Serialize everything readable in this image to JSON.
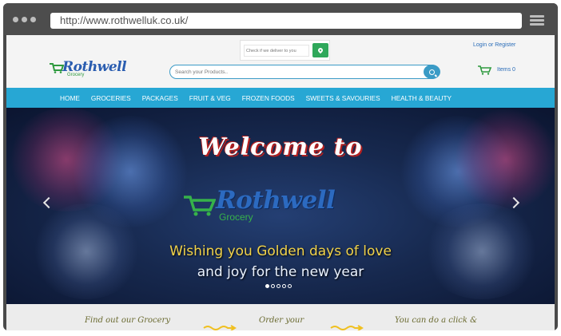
{
  "browser": {
    "url": "http://www.rothwelluk.co.uk/"
  },
  "header": {
    "deliver_placeholder": "Check if we deliver to you",
    "login_label": "Login or Register",
    "logo_text": "Rothwell",
    "logo_sub": "Grocery",
    "search_placeholder": "Search your Products..",
    "cart_label": "Items 0"
  },
  "nav": {
    "items": [
      "HOME",
      "GROCERIES",
      "PACKAGES",
      "FRUIT & VEG",
      "FROZEN FOODS",
      "SWEETS & SAVOURIES",
      "HEALTH & BEAUTY"
    ]
  },
  "hero": {
    "welcome": "Welcome to",
    "logo_text": "Rothwell",
    "logo_sub": "Grocery",
    "tagline_1": "Wishing you Golden days of love",
    "tagline_2": "and joy for the new year",
    "slides": 5,
    "active_slide": 1
  },
  "steps": {
    "step_1": "Find out our Grocery",
    "step_2": "Order your",
    "step_3": "You can do a click &"
  },
  "colors": {
    "nav_bg": "#27a7d4",
    "brand_blue": "#2a5db0",
    "brand_green": "#2e9a3e",
    "tagline_gold": "#f2d34a"
  }
}
